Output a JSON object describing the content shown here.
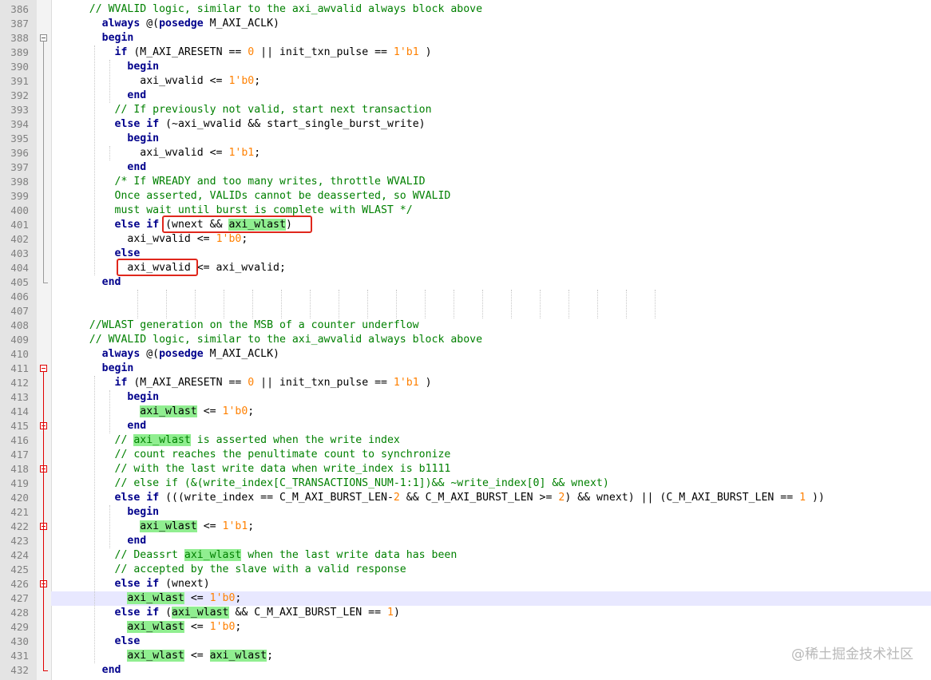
{
  "watermark": "@稀土掘金技术社区",
  "lines": [
    {
      "n": "386",
      "segs": [
        [
          "    ",
          ""
        ],
        [
          "// WVALID logic, similar to the axi_awvalid always block above",
          "cm"
        ]
      ]
    },
    {
      "n": "387",
      "segs": [
        [
          "      ",
          ""
        ],
        [
          "always",
          "kw"
        ],
        [
          " @(",
          ""
        ],
        [
          "posedge",
          "kw"
        ],
        [
          " M_AXI_ACLK)",
          ""
        ]
      ]
    },
    {
      "n": "388",
      "segs": [
        [
          "      ",
          ""
        ],
        [
          "begin",
          "kw"
        ]
      ]
    },
    {
      "n": "389",
      "segs": [
        [
          "        ",
          ""
        ],
        [
          "if",
          "kw"
        ],
        [
          " (M_AXI_ARESETN == ",
          ""
        ],
        [
          "0",
          "nm"
        ],
        [
          " || init_txn_pulse == ",
          ""
        ],
        [
          "1'b1",
          "nm"
        ],
        [
          " )",
          ""
        ]
      ]
    },
    {
      "n": "390",
      "segs": [
        [
          "          ",
          ""
        ],
        [
          "begin",
          "kw"
        ]
      ]
    },
    {
      "n": "391",
      "segs": [
        [
          "            axi_wvalid <= ",
          ""
        ],
        [
          "1'b0",
          "nm"
        ],
        [
          ";",
          ""
        ]
      ]
    },
    {
      "n": "392",
      "segs": [
        [
          "          ",
          ""
        ],
        [
          "end",
          "kw"
        ]
      ]
    },
    {
      "n": "393",
      "segs": [
        [
          "        ",
          ""
        ],
        [
          "// If previously not valid, start next transaction",
          "cm"
        ]
      ]
    },
    {
      "n": "394",
      "segs": [
        [
          "        ",
          ""
        ],
        [
          "else",
          "kw"
        ],
        [
          " ",
          ""
        ],
        [
          "if",
          "kw"
        ],
        [
          " (~axi_wvalid && start_single_burst_write)",
          ""
        ]
      ]
    },
    {
      "n": "395",
      "segs": [
        [
          "          ",
          ""
        ],
        [
          "begin",
          "kw"
        ]
      ]
    },
    {
      "n": "396",
      "segs": [
        [
          "            axi_wvalid <= ",
          ""
        ],
        [
          "1'b1",
          "nm"
        ],
        [
          ";",
          ""
        ]
      ]
    },
    {
      "n": "397",
      "segs": [
        [
          "          ",
          ""
        ],
        [
          "end",
          "kw"
        ]
      ]
    },
    {
      "n": "398",
      "segs": [
        [
          "        ",
          ""
        ],
        [
          "/* If WREADY and too many writes, throttle WVALID",
          "cm"
        ]
      ]
    },
    {
      "n": "399",
      "segs": [
        [
          "        ",
          ""
        ],
        [
          "Once asserted, VALIDs cannot be deasserted, so WVALID",
          "cm"
        ]
      ]
    },
    {
      "n": "400",
      "segs": [
        [
          "        ",
          ""
        ],
        [
          "must wait until burst is complete with WLAST */",
          "cm"
        ]
      ]
    },
    {
      "n": "401",
      "segs": [
        [
          "        ",
          ""
        ],
        [
          "else",
          "kw"
        ],
        [
          " ",
          ""
        ],
        [
          "if",
          "kw"
        ],
        [
          " (wnext && ",
          ""
        ],
        [
          "axi_wlast",
          "hl"
        ],
        [
          ")",
          ""
        ]
      ]
    },
    {
      "n": "402",
      "segs": [
        [
          "          axi_wvalid <= ",
          ""
        ],
        [
          "1'b0",
          "nm"
        ],
        [
          ";",
          ""
        ]
      ]
    },
    {
      "n": "403",
      "segs": [
        [
          "        ",
          ""
        ],
        [
          "else",
          "kw"
        ]
      ]
    },
    {
      "n": "404",
      "segs": [
        [
          "          axi_wvalid <= axi_wvalid;",
          ""
        ]
      ]
    },
    {
      "n": "405",
      "segs": [
        [
          "      ",
          ""
        ],
        [
          "end",
          "kw"
        ]
      ]
    },
    {
      "n": "406",
      "segs": []
    },
    {
      "n": "407",
      "segs": []
    },
    {
      "n": "408",
      "segs": [
        [
          "    ",
          ""
        ],
        [
          "//WLAST generation on the MSB of a counter underflow",
          "cm"
        ]
      ]
    },
    {
      "n": "409",
      "segs": [
        [
          "    ",
          ""
        ],
        [
          "// WVALID logic, similar to the axi_awvalid always block above",
          "cm"
        ]
      ]
    },
    {
      "n": "410",
      "segs": [
        [
          "      ",
          ""
        ],
        [
          "always",
          "kw"
        ],
        [
          " @(",
          ""
        ],
        [
          "posedge",
          "kw"
        ],
        [
          " M_AXI_ACLK)",
          ""
        ]
      ]
    },
    {
      "n": "411",
      "segs": [
        [
          "      ",
          ""
        ],
        [
          "begin",
          "kw"
        ]
      ]
    },
    {
      "n": "412",
      "segs": [
        [
          "        ",
          ""
        ],
        [
          "if",
          "kw"
        ],
        [
          " (M_AXI_ARESETN == ",
          ""
        ],
        [
          "0",
          "nm"
        ],
        [
          " || init_txn_pulse == ",
          ""
        ],
        [
          "1'b1",
          "nm"
        ],
        [
          " )",
          ""
        ]
      ]
    },
    {
      "n": "413",
      "segs": [
        [
          "          ",
          ""
        ],
        [
          "begin",
          "kw"
        ]
      ]
    },
    {
      "n": "414",
      "segs": [
        [
          "            ",
          ""
        ],
        [
          "axi_wlast",
          "hl"
        ],
        [
          " <= ",
          ""
        ],
        [
          "1'b0",
          "nm"
        ],
        [
          ";",
          ""
        ]
      ]
    },
    {
      "n": "415",
      "segs": [
        [
          "          ",
          ""
        ],
        [
          "end",
          "kw"
        ]
      ]
    },
    {
      "n": "416",
      "segs": [
        [
          "        ",
          ""
        ],
        [
          "// ",
          "cm"
        ],
        [
          "axi_wlast",
          "cm hl"
        ],
        [
          " is asserted when the write index",
          "cm"
        ]
      ]
    },
    {
      "n": "417",
      "segs": [
        [
          "        ",
          ""
        ],
        [
          "// count reaches the penultimate count to synchronize",
          "cm"
        ]
      ]
    },
    {
      "n": "418",
      "segs": [
        [
          "        ",
          ""
        ],
        [
          "// with the last write data when write_index is b1111",
          "cm"
        ]
      ]
    },
    {
      "n": "419",
      "segs": [
        [
          "        ",
          ""
        ],
        [
          "// else if (&(write_index[C_TRANSACTIONS_NUM-1:1])&& ~write_index[0] && wnext)",
          "cm"
        ]
      ]
    },
    {
      "n": "420",
      "segs": [
        [
          "        ",
          ""
        ],
        [
          "else",
          "kw"
        ],
        [
          " ",
          ""
        ],
        [
          "if",
          "kw"
        ],
        [
          " (((write_index == C_M_AXI_BURST_LEN-",
          ""
        ],
        [
          "2",
          "nm"
        ],
        [
          " && C_M_AXI_BURST_LEN >= ",
          ""
        ],
        [
          "2",
          "nm"
        ],
        [
          ") && wnext) || (C_M_AXI_BURST_LEN == ",
          ""
        ],
        [
          "1",
          "nm"
        ],
        [
          " ))",
          ""
        ]
      ]
    },
    {
      "n": "421",
      "segs": [
        [
          "          ",
          ""
        ],
        [
          "begin",
          "kw"
        ]
      ]
    },
    {
      "n": "422",
      "segs": [
        [
          "            ",
          ""
        ],
        [
          "axi_wlast",
          "hl"
        ],
        [
          " <= ",
          ""
        ],
        [
          "1'b1",
          "nm"
        ],
        [
          ";",
          ""
        ]
      ]
    },
    {
      "n": "423",
      "segs": [
        [
          "          ",
          ""
        ],
        [
          "end",
          "kw"
        ]
      ]
    },
    {
      "n": "424",
      "segs": [
        [
          "        ",
          ""
        ],
        [
          "// Deassrt ",
          "cm"
        ],
        [
          "axi_wlast",
          "cm hl"
        ],
        [
          " when the last write data has been",
          "cm"
        ]
      ]
    },
    {
      "n": "425",
      "segs": [
        [
          "        ",
          ""
        ],
        [
          "// accepted by the slave with a valid response",
          "cm"
        ]
      ]
    },
    {
      "n": "426",
      "segs": [
        [
          "        ",
          ""
        ],
        [
          "else",
          "kw"
        ],
        [
          " ",
          ""
        ],
        [
          "if",
          "kw"
        ],
        [
          " (wnext)",
          ""
        ]
      ]
    },
    {
      "n": "427",
      "segs": [
        [
          "          ",
          ""
        ],
        [
          "axi_wlast",
          "hl"
        ],
        [
          " <= ",
          ""
        ],
        [
          "1'b0",
          "nm"
        ],
        [
          ";",
          ""
        ]
      ]
    },
    {
      "n": "428",
      "segs": [
        [
          "        ",
          ""
        ],
        [
          "else",
          "kw"
        ],
        [
          " ",
          ""
        ],
        [
          "if",
          "kw"
        ],
        [
          " (",
          ""
        ],
        [
          "axi_wlast",
          "hl"
        ],
        [
          " && C_M_AXI_BURST_LEN == ",
          ""
        ],
        [
          "1",
          "nm"
        ],
        [
          ")",
          ""
        ]
      ]
    },
    {
      "n": "429",
      "segs": [
        [
          "          ",
          ""
        ],
        [
          "axi_wlast",
          "hl"
        ],
        [
          " <= ",
          ""
        ],
        [
          "1'b0",
          "nm"
        ],
        [
          ";",
          ""
        ]
      ]
    },
    {
      "n": "430",
      "segs": [
        [
          "        ",
          ""
        ],
        [
          "else",
          "kw"
        ]
      ]
    },
    {
      "n": "431",
      "segs": [
        [
          "          ",
          ""
        ],
        [
          "axi_wlast",
          "hl"
        ],
        [
          " <= ",
          ""
        ],
        [
          "axi_wlast",
          "hl"
        ],
        [
          ";",
          ""
        ]
      ]
    },
    {
      "n": "432",
      "segs": [
        [
          "      ",
          ""
        ],
        [
          "end",
          "kw"
        ]
      ]
    }
  ]
}
